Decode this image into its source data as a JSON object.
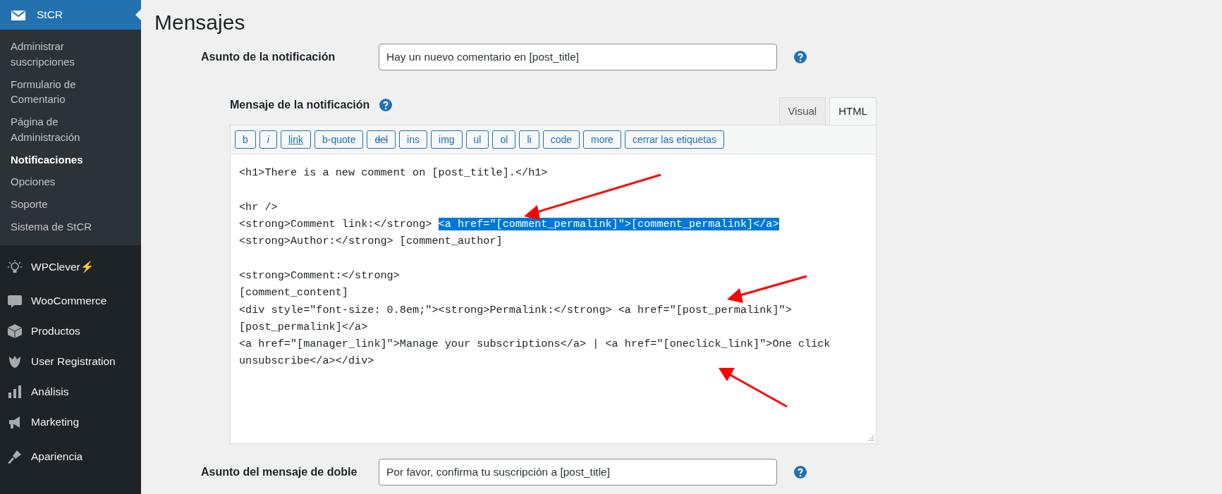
{
  "sidebar": {
    "header": {
      "label": "StCR",
      "selected": true
    },
    "submenu": [
      {
        "label": "Administrar suscripciones",
        "selected": false
      },
      {
        "label": "Formulario de Comentario",
        "selected": false
      },
      {
        "label": "Página de Administración",
        "selected": false
      },
      {
        "label": "Notificaciones",
        "selected": true
      },
      {
        "label": "Opciones",
        "selected": false
      },
      {
        "label": "Soporte",
        "selected": false
      },
      {
        "label": "Sistema de StCR",
        "selected": false
      }
    ],
    "items": [
      {
        "label": "WPClever",
        "kind": "bulb",
        "badge": "⚡"
      },
      {
        "label": "WooCommerce",
        "kind": "woo"
      },
      {
        "label": "Productos",
        "kind": "box"
      },
      {
        "label": "User Registration",
        "kind": "ur"
      },
      {
        "label": "Análisis",
        "kind": "bars"
      },
      {
        "label": "Marketing",
        "kind": "megaphone"
      },
      {
        "label": "Apariencia",
        "kind": "brush"
      }
    ]
  },
  "page": {
    "title": "Mensajes",
    "subject": {
      "label": "Asunto de la notificación",
      "value": "Hay un nuevo comentario en [post_title]"
    },
    "message": {
      "label": "Mensaje de la notificación",
      "tabs": [
        {
          "label": "Visual",
          "selected": false
        },
        {
          "label": "HTML",
          "selected": true
        }
      ],
      "toolbar": [
        {
          "label": "b",
          "kind": "plain"
        },
        {
          "label": "i",
          "kind": "italic"
        },
        {
          "label": "link",
          "kind": "link"
        },
        {
          "label": "b-quote",
          "kind": "plain"
        },
        {
          "label": "del",
          "kind": "strike"
        },
        {
          "label": "ins",
          "kind": "plain"
        },
        {
          "label": "img",
          "kind": "plain"
        },
        {
          "label": "ul",
          "kind": "plain"
        },
        {
          "label": "ol",
          "kind": "plain"
        },
        {
          "label": "li",
          "kind": "plain"
        },
        {
          "label": "code",
          "kind": "plain"
        },
        {
          "label": "more",
          "kind": "plain"
        },
        {
          "label": "cerrar las etiquetas",
          "kind": "plain"
        }
      ],
      "lines": [
        {
          "kind": "text",
          "segments": [
            {
              "text": "<h1>There is a new comment on [post_title].</h1>",
              "selected": false
            }
          ]
        },
        {
          "kind": "blank"
        },
        {
          "kind": "text",
          "segments": [
            {
              "text": "<hr />",
              "selected": false
            }
          ]
        },
        {
          "kind": "text",
          "segments": [
            {
              "text": "<strong>Comment link:</strong> ",
              "selected": false
            },
            {
              "text": "<a href=\"[comment_permalink]\">[comment_permalink]</a>",
              "selected": true
            }
          ]
        },
        {
          "kind": "text",
          "segments": [
            {
              "text": "<strong>Author:</strong> [comment_author]",
              "selected": false
            }
          ]
        },
        {
          "kind": "blank"
        },
        {
          "kind": "text",
          "segments": [
            {
              "text": "<strong>Comment:</strong>",
              "selected": false
            }
          ]
        },
        {
          "kind": "text",
          "segments": [
            {
              "text": "[comment_content]",
              "selected": false
            }
          ]
        },
        {
          "kind": "text",
          "segments": [
            {
              "text": "<div style=\"font-size: 0.8em;\"><strong>Permalink:</strong> <a href=\"[post_permalink]\">",
              "selected": false
            }
          ]
        },
        {
          "kind": "text",
          "segments": [
            {
              "text": "[post_permalink]</a>",
              "selected": false
            }
          ]
        },
        {
          "kind": "text",
          "segments": [
            {
              "text": "<a href=\"[manager_link]\">Manage your subscriptions</a> | <a href=\"[oneclick_link]\">One click",
              "selected": false
            }
          ]
        },
        {
          "kind": "text",
          "segments": [
            {
              "text": "unsubscribe</a></div>",
              "selected": false
            }
          ]
        }
      ]
    },
    "double": {
      "label": "Asunto del mensaje de doble",
      "value": "Por favor, confirma tu suscripción a [post_title]"
    }
  }
}
